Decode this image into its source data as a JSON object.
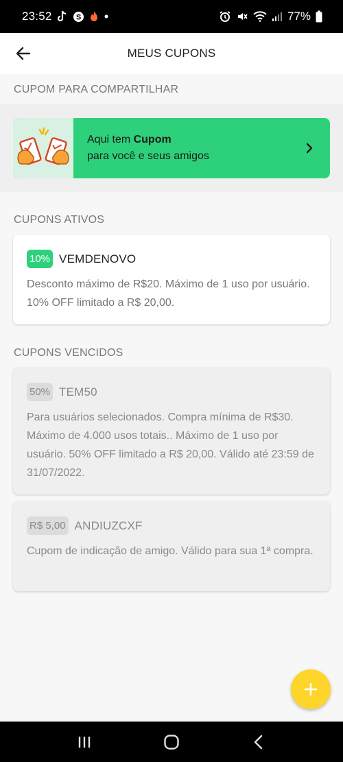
{
  "status_bar": {
    "time": "23:52",
    "battery": "77%",
    "icons": [
      "tiktok-icon",
      "s-circle-icon",
      "flame-icon",
      "dot-icon",
      "alarm-icon",
      "mute-icon",
      "wifi-icon",
      "signal-icon",
      "battery-icon"
    ]
  },
  "header": {
    "title": "MEUS CUPONS",
    "back_icon": "arrow-left-icon"
  },
  "share_section": {
    "title": "CUPOM PARA COMPARTILHAR",
    "card_line1_prefix": "Aqui tem ",
    "card_line1_bold": "Cupom",
    "card_line2": "para você e seus amigos",
    "chevron_icon": "chevron-right-icon"
  },
  "active_section": {
    "title": "CUPONS ATIVOS",
    "coupons": [
      {
        "badge": "10%",
        "code": "VEMDENOVO",
        "description": "Desconto máximo de R$20. Máximo de 1 uso por usuário. 10% OFF limitado a R$ 20,00."
      }
    ]
  },
  "expired_section": {
    "title": "CUPONS VENCIDOS",
    "coupons": [
      {
        "badge": "50%",
        "code": "TEM50",
        "description": "Para usuários selecionados. Compra mínima de R$30. Máximo de 4.000 usos totais.. Máximo de 1 uso por usuário. 50% OFF limitado a R$ 20,00. Válido até 23:59 de 31/07/2022."
      },
      {
        "badge": "R$ 5,00",
        "code": "ANDIUZCXF",
        "description": "Cupom de indicação de amigo. Válido para sua 1ª compra."
      }
    ]
  },
  "fab": {
    "icon": "plus-icon"
  },
  "nav_bar": {
    "icons": [
      "recent-apps-icon",
      "home-icon",
      "back-icon"
    ]
  },
  "colors": {
    "accent_green": "#2ed17b",
    "fab_yellow": "#fdd52b",
    "illustration_bg": "#d8f1e3"
  }
}
